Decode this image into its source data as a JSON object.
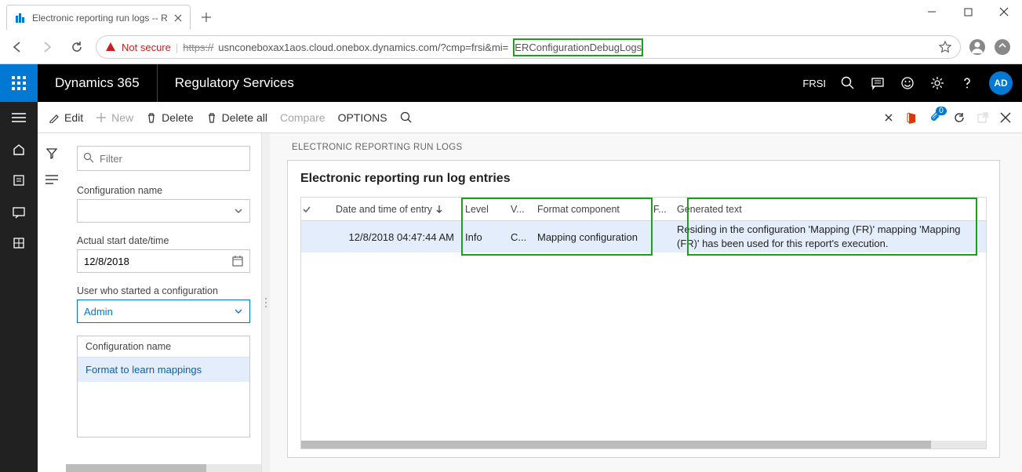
{
  "browser": {
    "tab_icon": "d365",
    "tab_title": "Electronic reporting run logs -- R",
    "not_secure": "Not secure",
    "url_protocol": "https://",
    "url_host": "usnconeboxax1aos.cloud.onebox.dynamics.com/?cmp=frsi&mi=",
    "url_param": "ERConfigurationDebugLogs"
  },
  "topbar": {
    "brand": "Dynamics 365",
    "module": "Regulatory Services",
    "company": "FRSI",
    "avatar": "AD"
  },
  "action_pane": {
    "edit": "Edit",
    "new": "New",
    "delete": "Delete",
    "delete_all": "Delete all",
    "compare": "Compare",
    "options": "OPTIONS",
    "badge": "0"
  },
  "filters": {
    "filter_placeholder": "Filter",
    "config_name_label": "Configuration name",
    "config_name_value": "",
    "actual_start_label": "Actual start date/time",
    "actual_start_value": "12/8/2018",
    "user_label": "User who started a configuration",
    "user_value": "Admin",
    "config_box_header": "Configuration name",
    "config_box_item": "Format to learn mappings"
  },
  "detail": {
    "section_label": "ELECTRONIC REPORTING RUN LOGS",
    "card_title": "Electronic reporting run log entries",
    "columns": {
      "date": "Date and time of entry",
      "level": "Level",
      "v": "V...",
      "component": "Format component",
      "f": "F...",
      "generated": "Generated text"
    },
    "row": {
      "date": "12/8/2018 04:47:44 AM",
      "level": "Info",
      "v": "C...",
      "component": "Mapping configuration",
      "f": "",
      "generated": "Residing in the configuration 'Mapping (FR)' mapping 'Mapping (FR)' has been used for this report's execution."
    }
  }
}
